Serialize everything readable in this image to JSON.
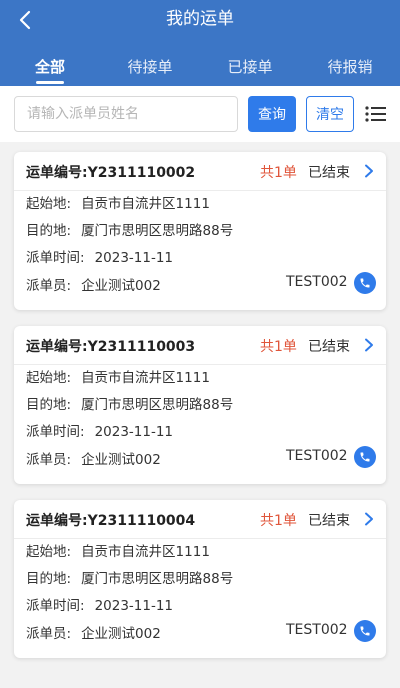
{
  "header": {
    "title": "我的运单",
    "tabs": [
      "全部",
      "待接单",
      "已接单",
      "待报销"
    ],
    "active_tab": 0
  },
  "search": {
    "placeholder": "请输入派单员姓名",
    "query_label": "查询",
    "clear_label": "清空"
  },
  "labels": {
    "order_no": "运单编号:",
    "start": "起始地:",
    "dest": "目的地:",
    "dispatch_time": "派单时间:",
    "dispatcher": "派单员:"
  },
  "orders": [
    {
      "order_no": "Y2311110002",
      "count": "共1单",
      "status": "已结束",
      "start": "自贡市自流井区1111",
      "dest": "厦门市思明区思明路88号",
      "dispatch_time": "2023-11-11",
      "dispatcher": "企业测试002",
      "dispatcher_code": "TEST002"
    },
    {
      "order_no": "Y2311110003",
      "count": "共1单",
      "status": "已结束",
      "start": "自贡市自流井区1111",
      "dest": "厦门市思明区思明路88号",
      "dispatch_time": "2023-11-11",
      "dispatcher": "企业测试002",
      "dispatcher_code": "TEST002"
    },
    {
      "order_no": "Y2311110004",
      "count": "共1单",
      "status": "已结束",
      "start": "自贡市自流井区1111",
      "dest": "厦门市思明区思明路88号",
      "dispatch_time": "2023-11-11",
      "dispatcher": "企业测试002",
      "dispatcher_code": "TEST002"
    }
  ],
  "colors": {
    "header_bg": "#3c76c6",
    "accent": "#2f7bea",
    "count_red": "#e0563b"
  },
  "icons": {
    "back": "chevron-left-icon",
    "menu": "list-menu-icon",
    "arrow": "chevron-right-icon",
    "phone": "phone-icon"
  }
}
